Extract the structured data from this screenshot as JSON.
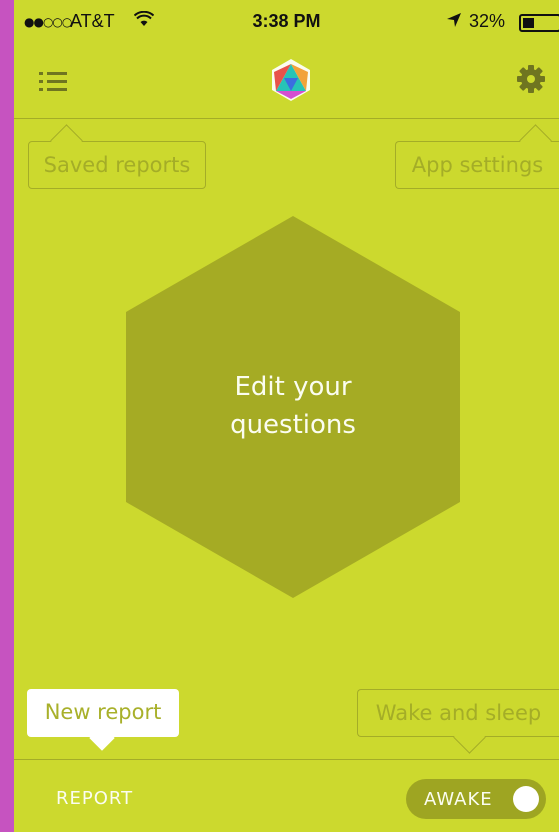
{
  "status_bar": {
    "signal": "●●○○○",
    "carrier": "AT&T",
    "wifi_icon": "wifi-icon",
    "time": "3:38 PM",
    "location_icon": "location-arrow-icon",
    "battery_percent": "32%",
    "battery_level": 0.32
  },
  "nav": {
    "menu_icon": "list-menu-icon",
    "logo_icon": "hexagon-logo-icon",
    "settings_icon": "gear-icon"
  },
  "tooltips": {
    "saved_reports": "Saved reports",
    "app_settings": "App settings",
    "new_report": "New report",
    "wake_and_sleep": "Wake and sleep"
  },
  "center": {
    "edit_line1": "Edit your",
    "edit_line2": "questions"
  },
  "bottom_bar": {
    "report_tab": "REPORT",
    "awake_toggle": "AWAKE",
    "awake_on": true
  },
  "colors": {
    "background": "#ccd92e",
    "hexagon": "#a5ab24",
    "outline": "#a4ad27",
    "frame": "#c653c0"
  }
}
